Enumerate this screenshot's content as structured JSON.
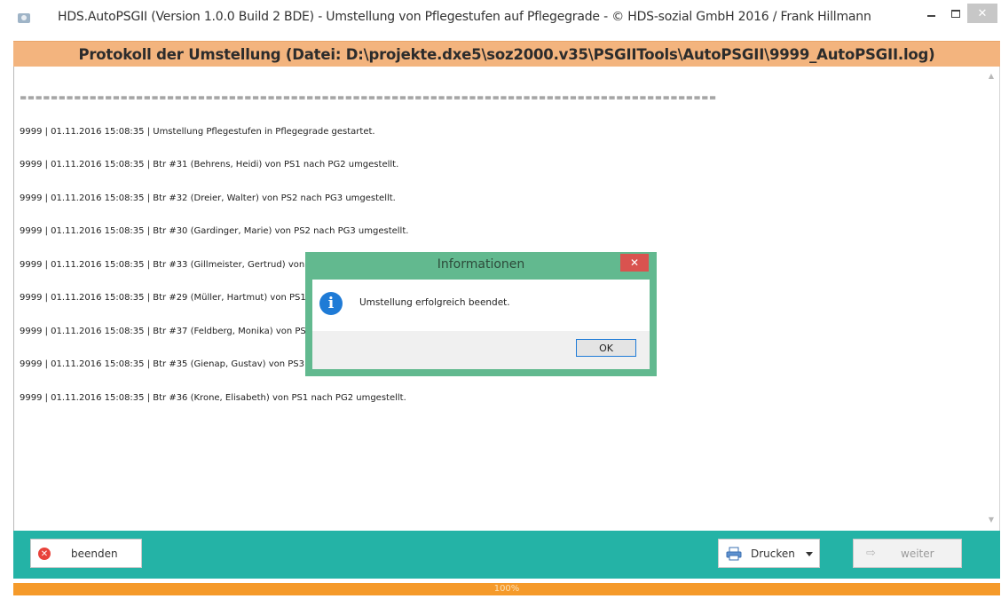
{
  "window": {
    "title": "HDS.AutoPSGII (Version 1.0.0 Build 2 BDE) - Umstellung von Pflegestufen auf Pflegegrade - © HDS-sozial GmbH 2016 / Frank Hillmann",
    "minimize_label": "–",
    "close_label": "✕"
  },
  "header": {
    "title": "Protokoll der Umstellung (Datei: D:\\projekte.dxe5\\soz2000.v35\\PSGIITools\\AutoPSGII\\9999_AutoPSGII.log)"
  },
  "log": {
    "separator": "==========================================================================================",
    "lines": [
      "9999 | 01.11.2016 15:08:35 | Umstellung Pflegestufen in Pflegegrade gestartet.",
      "9999 | 01.11.2016 15:08:35 | Btr #31 (Behrens, Heidi) von PS1 nach PG2 umgestellt.",
      "9999 | 01.11.2016 15:08:35 | Btr #32 (Dreier, Walter) von PS2 nach PG3 umgestellt.",
      "9999 | 01.11.2016 15:08:35 | Btr #30 (Gardinger, Marie) von PS2 nach PG3 umgestellt.",
      "9999 | 01.11.2016 15:08:35 | Btr #33 (Gillmeister, Gertrud) von PS3 nach PG4 umgestellt.",
      "9999 | 01.11.2016 15:08:35 | Btr #29 (Müller, Hartmut) von PS1 nach PG2 umgestellt.",
      "9999 | 01.11.2016 15:08:35 | Btr #37 (Feldberg, Monika) von PS1 nach PG2 umgestellt.",
      "9999 | 01.11.2016 15:08:35 | Btr #35 (Gienap, Gustav) von PS3 nach PG4 umgestellt.",
      "9999 | 01.11.2016 15:08:35 | Btr #36 (Krone, Elisabeth) von PS1 nach PG2 umgestellt."
    ]
  },
  "dialog": {
    "title": "Informationen",
    "close_label": "✕",
    "icon_letter": "i",
    "message": "Umstellung erfolgreich beendet.",
    "ok_label": "OK"
  },
  "toolbar": {
    "beenden_label": "beenden",
    "drucken_label": "Drucken",
    "weiter_label": "weiter"
  },
  "progress": {
    "value": 100,
    "label": "100%"
  },
  "colors": {
    "header": "#f3b47e",
    "toolbar": "#24b3a6",
    "dialog_frame": "#62b98f",
    "progress": "#f59a2a"
  }
}
